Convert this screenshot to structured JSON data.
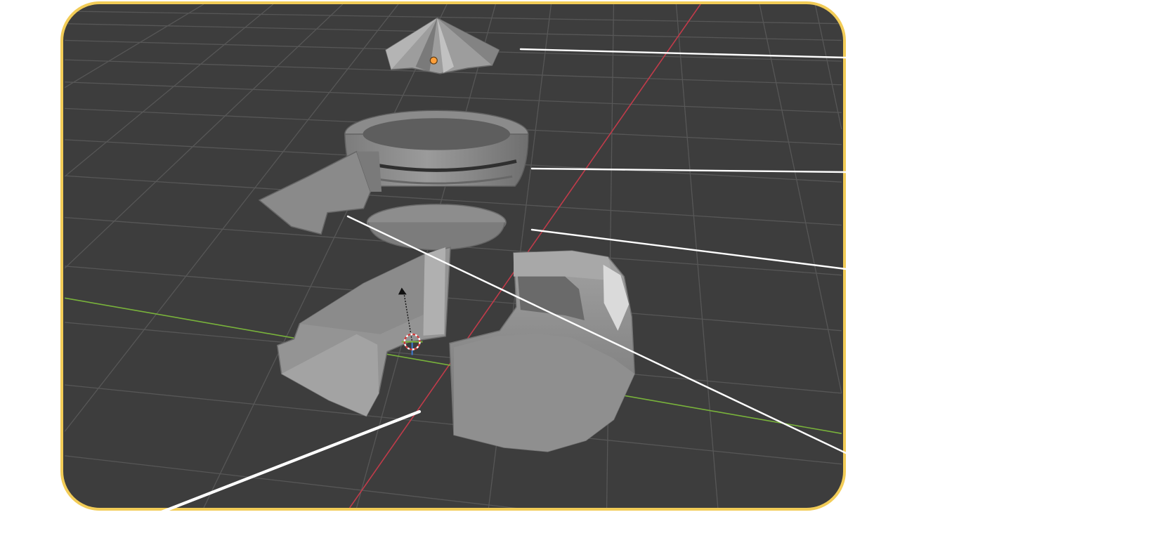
{
  "diagram": {
    "frame_color": "#f2cc57",
    "viewport_background": "#3d3d3d",
    "grid_color": "#555555",
    "x_axis_color": "#c23b4a",
    "y_axis_color": "#79b33b",
    "model_color": "#8f8f8f",
    "callout_color": "#ffffff",
    "icons": {
      "origin": "origin-dot-icon",
      "cursor": "3d-cursor-icon",
      "gizmo": "transform-gizmo-icon"
    }
  }
}
